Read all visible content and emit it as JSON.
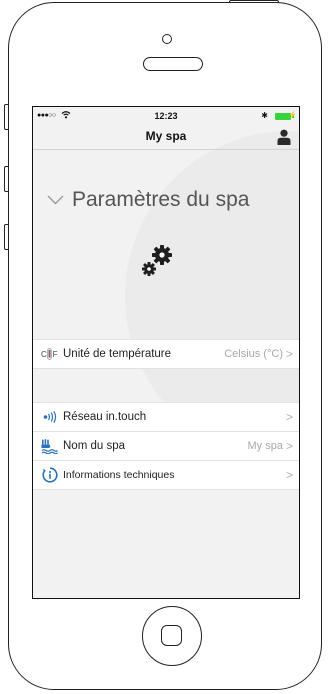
{
  "status_bar": {
    "signal": "●●●○○",
    "time": "12:23",
    "bluetooth": "✱"
  },
  "nav": {
    "title": "My spa"
  },
  "section": {
    "title": "Paramètres du spa"
  },
  "rows_group1": [
    {
      "label": "Unité de température",
      "value": "Celsius (°C)",
      "icon": "thermometer-cf-icon"
    }
  ],
  "rows_group2": [
    {
      "label": "Réseau in.touch",
      "value": "",
      "icon": "wireless-signal-icon"
    },
    {
      "label": "Nom du spa",
      "value": "My spa",
      "icon": "spa-hand-icon"
    },
    {
      "label": "Informations techniques",
      "value": "",
      "icon": "info-icon"
    }
  ],
  "chevron": ">",
  "colors": {
    "accent_blue": "#2a72b8",
    "battery_green": "#37d33a",
    "background": "#f2f2f2"
  }
}
